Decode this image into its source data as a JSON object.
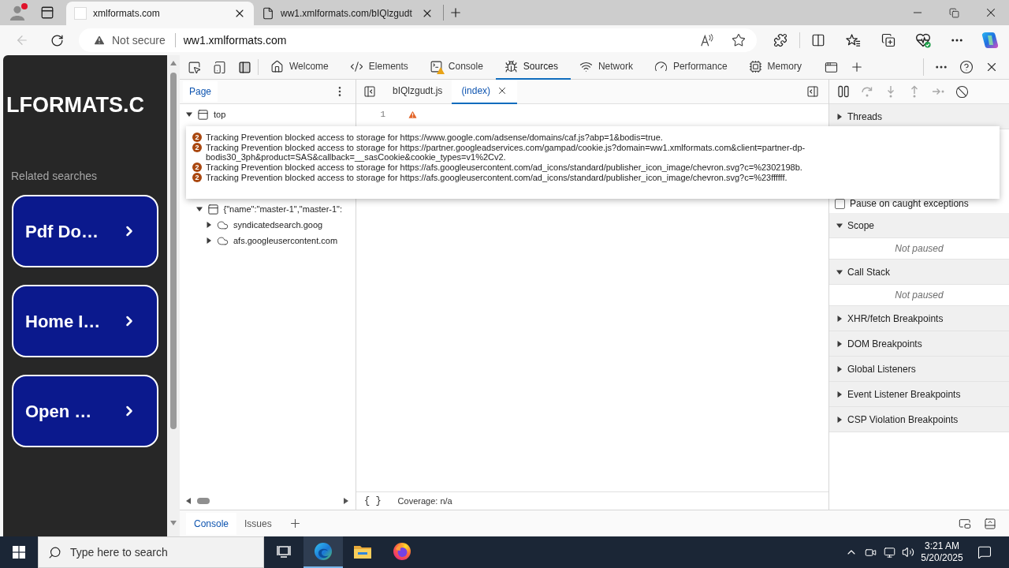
{
  "browser": {
    "profile": {
      "notification": true
    },
    "tabs": [
      {
        "title": "xmlformats.com",
        "selected": true,
        "kind": "blank"
      },
      {
        "title": "ww1.xmlformats.com/bIQlzgudt",
        "selected": false,
        "kind": "page"
      }
    ],
    "back_button": {
      "disabled": true
    },
    "address": {
      "security": "Not secure",
      "url": "ww1.xmlformats.com"
    }
  },
  "page": {
    "logo": "LFORMATS.C",
    "related_title": "Related searches",
    "related": [
      {
        "label": "Pdf Do…"
      },
      {
        "label": "Home I…"
      },
      {
        "label": "Open …"
      }
    ]
  },
  "devtools": {
    "tabs": [
      {
        "label": "Welcome",
        "selected": false,
        "warning": false
      },
      {
        "label": "Elements",
        "selected": false,
        "warning": false
      },
      {
        "label": "Console",
        "selected": false,
        "warning": true
      },
      {
        "label": "Sources",
        "selected": true,
        "warning": false
      },
      {
        "label": "Network",
        "selected": false,
        "warning": false
      },
      {
        "label": "Performance",
        "selected": false,
        "warning": false
      },
      {
        "label": "Memory",
        "selected": false,
        "warning": false
      }
    ],
    "navigator": {
      "tabs": [
        {
          "label": "Page",
          "selected": true
        }
      ],
      "tree": [
        {
          "label": "top",
          "kind": "frame",
          "expanded": true,
          "children": [
            {
              "label": "{\"name\":\"master-1\",\"master-1\":",
              "kind": "frame",
              "expanded": true,
              "children": [
                {
                  "label": "syndicatedsearch.goog",
                  "kind": "origin",
                  "expanded": false
                },
                {
                  "label": "afs.googleusercontent.com",
                  "kind": "origin",
                  "expanded": false
                }
              ]
            }
          ]
        }
      ]
    },
    "editor": {
      "tabs": [
        {
          "label": "bIQlzgudt.js",
          "selected": false
        },
        {
          "label": "(index)",
          "selected": true
        }
      ],
      "lines": [
        {
          "number": "1",
          "warning": true
        }
      ],
      "format_button": "{ }",
      "coverage": "Coverage: n/a"
    },
    "tooltip": {
      "messages": [
        {
          "count": "2",
          "text": "Tracking Prevention blocked access to storage for https://www.google.com/adsense/domains/caf.js?abp=1&bodis=true."
        },
        {
          "count": "2",
          "text": "Tracking Prevention blocked access to storage for https://partner.googleadservices.com/gampad/cookie.js?domain=ww1.xmlformats.com&client=partner-dp-bodis30_3ph&product=SAS&callback=__sasCookie&cookie_types=v1%2Cv2."
        },
        {
          "count": "2",
          "text": "Tracking Prevention blocked access to storage for https://afs.googleusercontent.com/ad_icons/standard/publisher_icon_image/chevron.svg?c=%2302198b."
        },
        {
          "count": "2",
          "text": "Tracking Prevention blocked access to storage for https://afs.googleusercontent.com/ad_icons/standard/publisher_icon_image/chevron.svg?c=%23ffffff."
        }
      ]
    },
    "debugger": {
      "sections": [
        {
          "kind": "pane",
          "label": "Threads",
          "expanded": false
        },
        {
          "kind": "checkbox",
          "label": "Pause on caught exceptions",
          "checked": false
        },
        {
          "kind": "pane",
          "label": "Scope",
          "expanded": true
        },
        {
          "kind": "empty",
          "label": "Not paused"
        },
        {
          "kind": "pane",
          "label": "Call Stack",
          "expanded": true
        },
        {
          "kind": "empty",
          "label": "Not paused"
        },
        {
          "kind": "pane",
          "label": "XHR/fetch Breakpoints",
          "expanded": false
        },
        {
          "kind": "pane",
          "label": "DOM Breakpoints",
          "expanded": false
        },
        {
          "kind": "pane",
          "label": "Global Listeners",
          "expanded": false
        },
        {
          "kind": "pane",
          "label": "Event Listener Breakpoints",
          "expanded": false
        },
        {
          "kind": "pane",
          "label": "CSP Violation Breakpoints",
          "expanded": false
        }
      ]
    },
    "drawer": {
      "tabs": [
        {
          "label": "Console",
          "selected": true
        },
        {
          "label": "Issues",
          "selected": false
        }
      ]
    }
  },
  "taskbar": {
    "search": {
      "placeholder": "Type here to search"
    },
    "apps": [
      {
        "kind": "task-view",
        "selected": false
      },
      {
        "kind": "edge",
        "selected": true
      },
      {
        "kind": "explorer",
        "selected": false
      },
      {
        "kind": "firefox",
        "selected": false
      }
    ],
    "clock": {
      "time": "3:21 AM",
      "date": "5/20/2025"
    }
  }
}
